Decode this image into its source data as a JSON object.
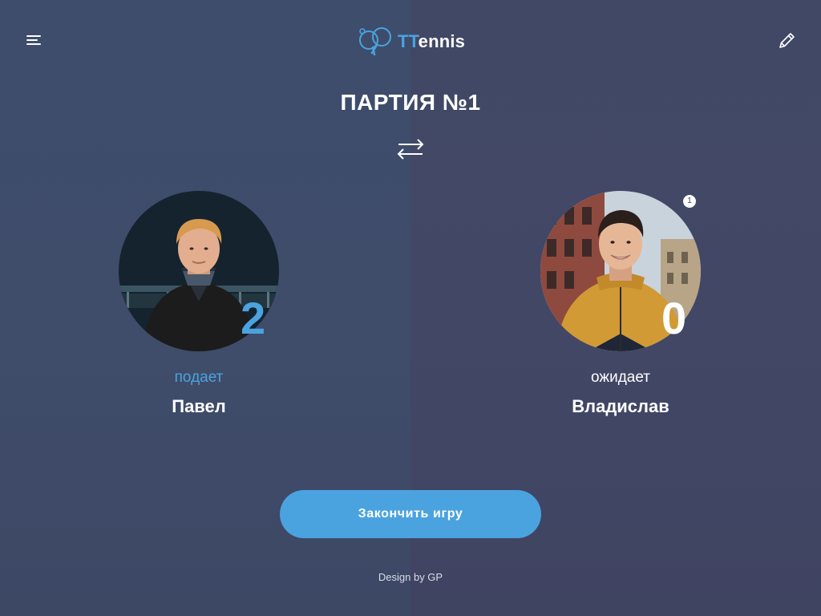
{
  "header": {
    "logo_text_accent": "TT",
    "logo_text_rest": "ennis",
    "menu_icon": "hamburger-menu-icon",
    "edit_icon": "pencil-icon",
    "logo_icon": "ping-pong-paddles-icon"
  },
  "game": {
    "title": "ПАРТИЯ №1",
    "swap_icon": "swap-arrows-icon"
  },
  "players": [
    {
      "name": "Павел",
      "status": "подает",
      "score": "2",
      "status_color": "#4aa3df",
      "score_color": "#4aa3df"
    },
    {
      "name": "Владислав",
      "status": "ожидает",
      "score": "0",
      "badge": "1",
      "status_color": "#ffffff",
      "score_color": "#ffffff"
    }
  ],
  "actions": {
    "finish_label": "Закончить игру"
  },
  "footer": {
    "credit": "Design by GP"
  },
  "colors": {
    "accent": "#4aa3df",
    "background": "#3e4a68"
  }
}
